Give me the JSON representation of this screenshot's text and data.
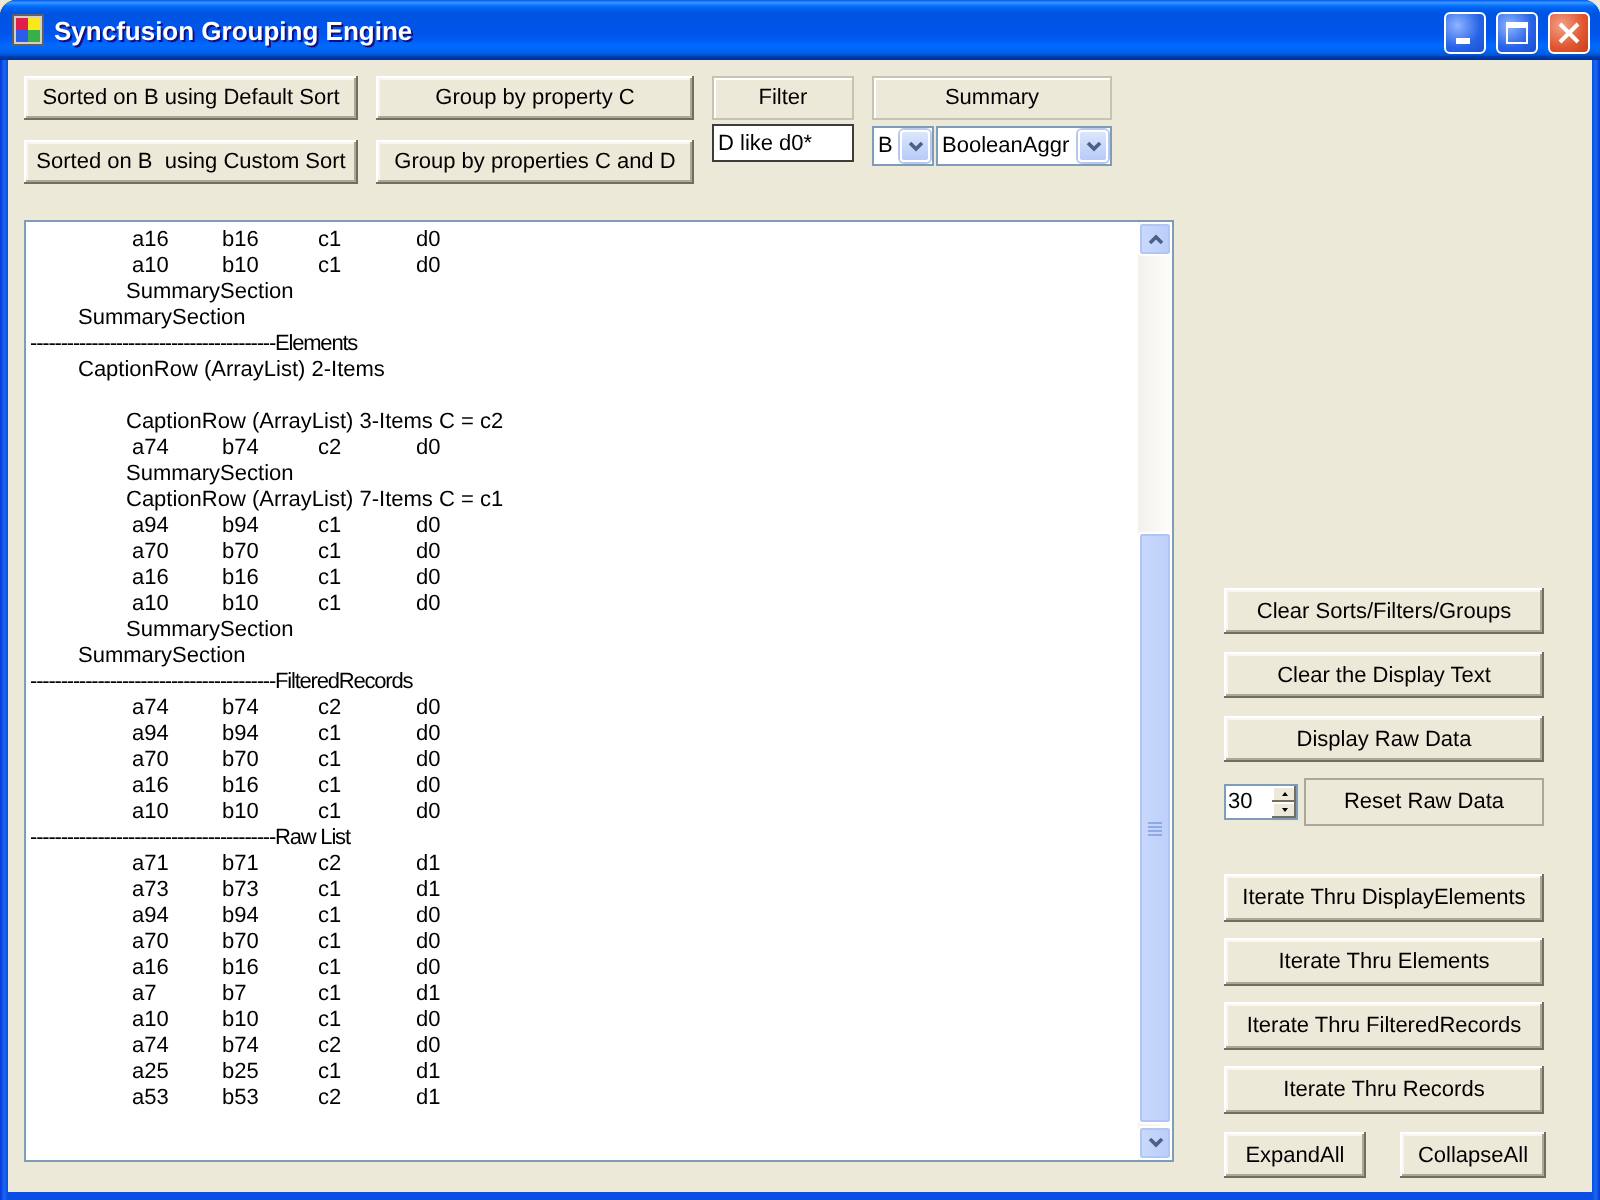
{
  "window": {
    "title": "Syncfusion Grouping Engine"
  },
  "sort_buttons": [
    "Sorted on B using Default Sort",
    "Sorted on B  using Custom Sort"
  ],
  "group_buttons": [
    "Group by property C",
    "Group by properties C and D"
  ],
  "filter": {
    "label": "Filter",
    "value": "D like d0*"
  },
  "summary": {
    "label": "Summary",
    "field": "B",
    "aggregate": "BooleanAggr"
  },
  "output": {
    "lines": [
      {
        "kind": "group",
        "children": [
          {
            "kind": "group",
            "children": [
              {
                "kind": "record",
                "cells": [
                  "a16",
                  "b16",
                  "c1",
                  "d0"
                ]
              },
              {
                "kind": "record",
                "cells": [
                  "a10",
                  "b10",
                  "c1",
                  "d0"
                ]
              }
            ],
            "summary": "SummarySection"
          }
        ],
        "summary": "SummarySection"
      },
      {
        "kind": "separator",
        "text": "----------------------------------------Elements"
      },
      {
        "kind": "group",
        "caption": "CaptionRow (ArrayList) 2-Items",
        "children": [
          {
            "kind": "blank"
          },
          {
            "kind": "group",
            "caption": "CaptionRow (ArrayList) 3-Items C = c2",
            "children": [
              {
                "kind": "record",
                "cells": [
                  "a74",
                  "b74",
                  "c2",
                  "d0"
                ]
              }
            ],
            "summary": "SummarySection"
          },
          {
            "kind": "group",
            "caption": "CaptionRow (ArrayList) 7-Items C = c1",
            "children": [
              {
                "kind": "record",
                "cells": [
                  "a94",
                  "b94",
                  "c1",
                  "d0"
                ]
              },
              {
                "kind": "record",
                "cells": [
                  "a70",
                  "b70",
                  "c1",
                  "d0"
                ]
              },
              {
                "kind": "record",
                "cells": [
                  "a16",
                  "b16",
                  "c1",
                  "d0"
                ]
              },
              {
                "kind": "record",
                "cells": [
                  "a10",
                  "b10",
                  "c1",
                  "d0"
                ]
              }
            ],
            "summary": "SummarySection"
          }
        ],
        "summary": "SummarySection"
      },
      {
        "kind": "separator",
        "text": "----------------------------------------FilteredRecords"
      },
      {
        "kind": "record",
        "cells": [
          "a74",
          "b74",
          "c2",
          "d0"
        ]
      },
      {
        "kind": "record",
        "cells": [
          "a94",
          "b94",
          "c1",
          "d0"
        ]
      },
      {
        "kind": "record",
        "cells": [
          "a70",
          "b70",
          "c1",
          "d0"
        ]
      },
      {
        "kind": "record",
        "cells": [
          "a16",
          "b16",
          "c1",
          "d0"
        ]
      },
      {
        "kind": "record",
        "cells": [
          "a10",
          "b10",
          "c1",
          "d0"
        ]
      },
      {
        "kind": "separator",
        "text": "----------------------------------------Raw List"
      },
      {
        "kind": "record",
        "cells": [
          "a71",
          "b71",
          "c2",
          "d1"
        ]
      },
      {
        "kind": "record",
        "cells": [
          "a73",
          "b73",
          "c1",
          "d1"
        ]
      },
      {
        "kind": "record",
        "cells": [
          "a94",
          "b94",
          "c1",
          "d0"
        ]
      },
      {
        "kind": "record",
        "cells": [
          "a70",
          "b70",
          "c1",
          "d0"
        ]
      },
      {
        "kind": "record",
        "cells": [
          "a16",
          "b16",
          "c1",
          "d0"
        ]
      },
      {
        "kind": "record",
        "cells": [
          "a7",
          "b7",
          "c1",
          "d1"
        ]
      },
      {
        "kind": "record",
        "cells": [
          "a10",
          "b10",
          "c1",
          "d0"
        ]
      },
      {
        "kind": "record",
        "cells": [
          "a74",
          "b74",
          "c2",
          "d0"
        ]
      },
      {
        "kind": "record",
        "cells": [
          "a25",
          "b25",
          "c1",
          "d1"
        ]
      },
      {
        "kind": "record",
        "cells": [
          "a53",
          "b53",
          "c2",
          "d1"
        ]
      }
    ]
  },
  "side_panel": {
    "buttons": [
      "Clear Sorts/Filters/Groups",
      "Clear the Display Text",
      "Display Raw Data"
    ],
    "raw_data": {
      "count": "30",
      "button": "Reset Raw Data"
    },
    "iterate_buttons": [
      "Iterate Thru DisplayElements",
      "Iterate Thru Elements",
      "Iterate Thru FilteredRecords",
      "Iterate Thru Records"
    ],
    "tree_buttons": [
      "ExpandAll",
      "CollapseAll"
    ]
  }
}
